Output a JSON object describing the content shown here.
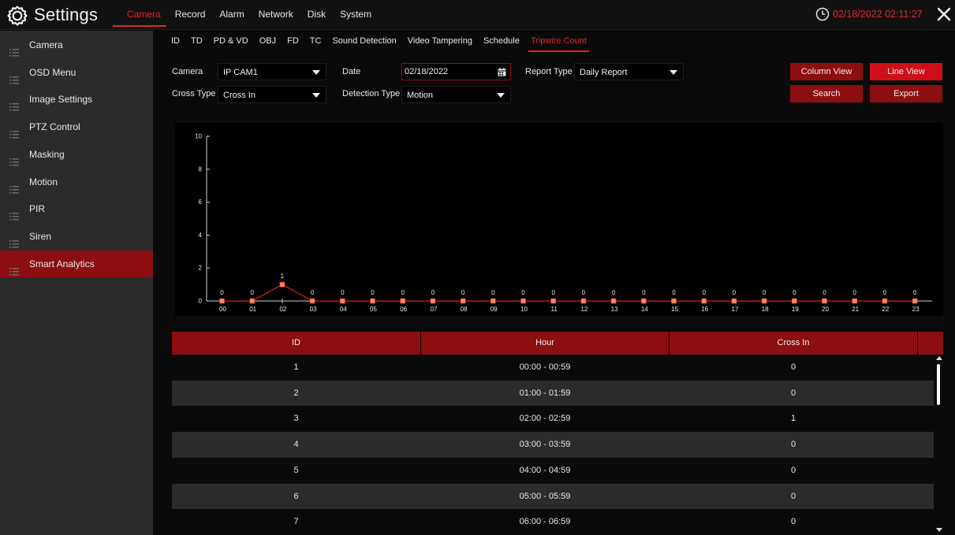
{
  "app": {
    "title": "Settings"
  },
  "topnav": [
    "Camera",
    "Record",
    "Alarm",
    "Network",
    "Disk",
    "System"
  ],
  "clock": "02/18/2022 02:11:27",
  "sidebar": [
    "Camera",
    "OSD Menu",
    "Image Settings",
    "PTZ Control",
    "Masking",
    "Motion",
    "PIR",
    "Siren",
    "Smart Analytics"
  ],
  "subtabs": [
    "ID",
    "TD",
    "PD & VD",
    "OBJ",
    "FD",
    "TC",
    "Sound Detection",
    "Video Tampering",
    "Schedule",
    "Tripwire Count"
  ],
  "form": {
    "camera_label": "Camera",
    "camera_value": "IP CAM1",
    "date_label": "Date",
    "date_value": "02/18/2022",
    "report_type_label": "Report Type",
    "report_type_value": "Daily Report",
    "cross_type_label": "Cross Type",
    "cross_type_value": "Cross In",
    "detection_type_label": "Detection Type",
    "detection_type_value": "Motion"
  },
  "buttons": {
    "column_view": "Column View",
    "line_view": "Line View",
    "search": "Search",
    "export": "Export"
  },
  "colors": {
    "accent": "#e0232b",
    "accent_dark": "#8d0e10",
    "button_bright": "#cf0f17",
    "sidebar_bg": "#2b2b2b",
    "bg": "#0a0a0a",
    "line": "#d32020",
    "marker": "#f08a6c"
  },
  "chart_data": {
    "type": "line",
    "categories": [
      "00",
      "01",
      "02",
      "03",
      "04",
      "05",
      "06",
      "07",
      "08",
      "09",
      "10",
      "11",
      "12",
      "13",
      "14",
      "15",
      "16",
      "17",
      "18",
      "19",
      "20",
      "21",
      "22",
      "23"
    ],
    "values": [
      0,
      0,
      1,
      0,
      0,
      0,
      0,
      0,
      0,
      0,
      0,
      0,
      0,
      0,
      0,
      0,
      0,
      0,
      0,
      0,
      0,
      0,
      0,
      0
    ],
    "yticks": [
      "0",
      "2",
      "4",
      "6",
      "8",
      "10"
    ],
    "ylim": [
      0,
      10
    ]
  },
  "table": {
    "headers": [
      "ID",
      "Hour",
      "Cross In"
    ],
    "rows": [
      [
        "1",
        "00:00 - 00:59",
        "0"
      ],
      [
        "2",
        "01:00 - 01:59",
        "0"
      ],
      [
        "3",
        "02:00 - 02:59",
        "1"
      ],
      [
        "4",
        "03:00 - 03:59",
        "0"
      ],
      [
        "5",
        "04:00 - 04:59",
        "0"
      ],
      [
        "6",
        "05:00 - 05:59",
        "0"
      ],
      [
        "7",
        "06:00 - 06:59",
        "0"
      ]
    ]
  }
}
